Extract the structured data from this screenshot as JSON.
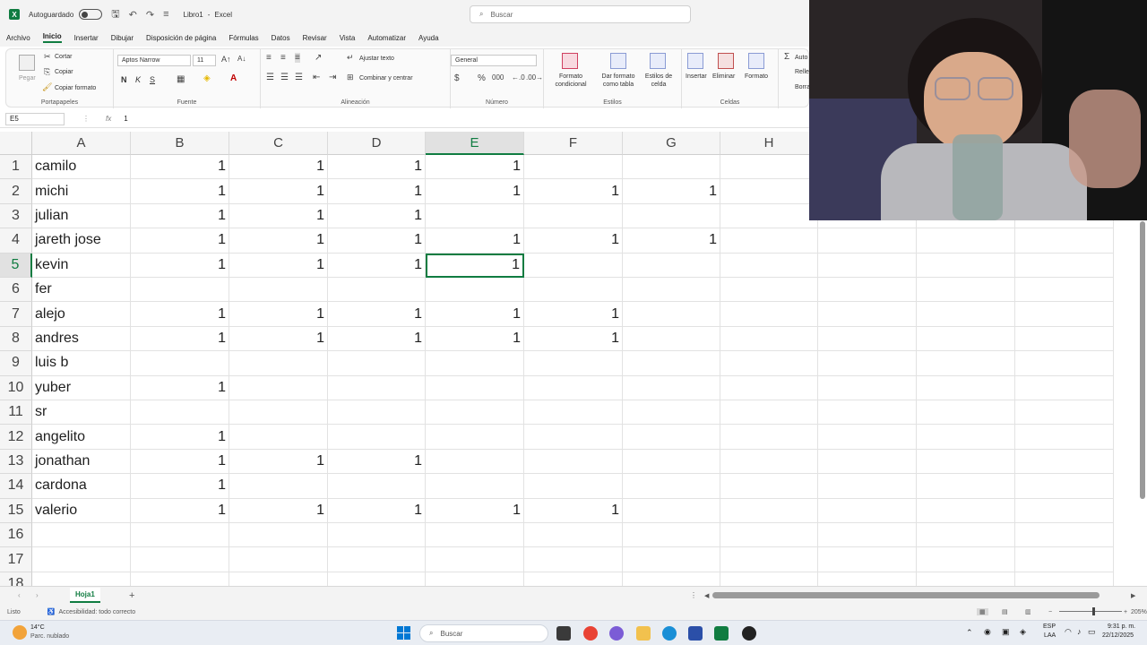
{
  "titlebar": {
    "autosave_label": "Autoguardado",
    "workbook": "Libro1",
    "separator": "-",
    "app": "Excel",
    "search_placeholder": "Buscar"
  },
  "menu": [
    "Archivo",
    "Inicio",
    "Insertar",
    "Dibujar",
    "Disposición de página",
    "Fórmulas",
    "Datos",
    "Revisar",
    "Vista",
    "Automatizar",
    "Ayuda"
  ],
  "menu_active": "Inicio",
  "ribbon": {
    "clipboard": {
      "label": "Portapapeles",
      "paste": "Pegar",
      "cut": "Cortar",
      "copy": "Copiar",
      "format_painter": "Copiar formato"
    },
    "font": {
      "label": "Fuente",
      "name": "Aptos Narrow",
      "size": "11",
      "bold": "N",
      "italic": "K",
      "underline": "S"
    },
    "alignment": {
      "label": "Alineación",
      "wrap": "Ajustar texto",
      "merge": "Combinar y centrar"
    },
    "number": {
      "label": "Número",
      "format": "General"
    },
    "styles": {
      "label": "Estilos",
      "cond": "Formato condicional",
      "table": "Dar formato como tabla",
      "cell": "Estilos de celda"
    },
    "cells": {
      "label": "Celdas",
      "insert": "Insertar",
      "delete": "Eliminar",
      "format": "Formato"
    },
    "editing": {
      "autosum": "Auto",
      "fill": "Relle",
      "clear": "Borra"
    }
  },
  "formula": {
    "namebox": "E5",
    "fx": "fx",
    "value": "1"
  },
  "columns": [
    "A",
    "B",
    "C",
    "D",
    "E",
    "F",
    "G",
    "H"
  ],
  "selected_column": "E",
  "selected_row": 5,
  "rows": [
    {
      "num": "1",
      "name": "camilo",
      "cells": [
        "1",
        "1",
        "1",
        "1",
        "",
        ""
      ]
    },
    {
      "num": "2",
      "name": "michi",
      "cells": [
        "1",
        "1",
        "1",
        "1",
        "1",
        "1"
      ]
    },
    {
      "num": "3",
      "name": "julian",
      "cells": [
        "1",
        "1",
        "1",
        "",
        "",
        ""
      ]
    },
    {
      "num": "4",
      "name": "jareth jose",
      "cells": [
        "1",
        "1",
        "1",
        "1",
        "1",
        "1"
      ]
    },
    {
      "num": "5",
      "name": "kevin",
      "cells": [
        "1",
        "1",
        "1",
        "1",
        "",
        ""
      ]
    },
    {
      "num": "6",
      "name": "fer",
      "cells": [
        "",
        "",
        "",
        "",
        "",
        ""
      ]
    },
    {
      "num": "7",
      "name": "alejo",
      "cells": [
        "1",
        "1",
        "1",
        "1",
        "1",
        ""
      ]
    },
    {
      "num": "8",
      "name": "andres",
      "cells": [
        "1",
        "1",
        "1",
        "1",
        "1",
        ""
      ]
    },
    {
      "num": "9",
      "name": "luis b",
      "cells": [
        "",
        "",
        "",
        "",
        "",
        ""
      ]
    },
    {
      "num": "10",
      "name": "yuber",
      "cells": [
        "1",
        "",
        "",
        "",
        "",
        ""
      ]
    },
    {
      "num": "11",
      "name": "sr",
      "cells": [
        "",
        "",
        "",
        "",
        "",
        ""
      ]
    },
    {
      "num": "12",
      "name": "angelito",
      "cells": [
        "1",
        "",
        "",
        "",
        "",
        ""
      ]
    },
    {
      "num": "13",
      "name": "jonathan",
      "cells": [
        "1",
        "1",
        "1",
        "",
        "",
        ""
      ]
    },
    {
      "num": "14",
      "name": "cardona",
      "cells": [
        "1",
        "",
        "",
        "",
        "",
        ""
      ]
    },
    {
      "num": "15",
      "name": "valerio",
      "cells": [
        "1",
        "1",
        "1",
        "1",
        "1",
        ""
      ]
    },
    {
      "num": "16",
      "name": "",
      "cells": [
        "",
        "",
        "",
        "",
        "",
        ""
      ]
    },
    {
      "num": "17",
      "name": "",
      "cells": [
        "",
        "",
        "",
        "",
        "",
        ""
      ]
    },
    {
      "num": "18",
      "name": "",
      "cells": [
        "",
        "",
        "",
        "",
        "",
        ""
      ]
    }
  ],
  "sheets": {
    "active": "Hoja1",
    "add": "+"
  },
  "status": {
    "ready": "Listo",
    "accessibility": "Accesibilidad: todo correcto",
    "zoom": "205%"
  },
  "taskbar": {
    "weather_temp": "14°C",
    "weather_desc": "Parc. nublado",
    "search": "Buscar",
    "lang": "ESP",
    "lang2": "LAA",
    "time": "9:31 p. m.",
    "date": "22/12/2025"
  },
  "colors": {
    "excel_green": "#107c41",
    "grid_line": "#e2e2e2",
    "header_bg": "#f5f5f5"
  }
}
